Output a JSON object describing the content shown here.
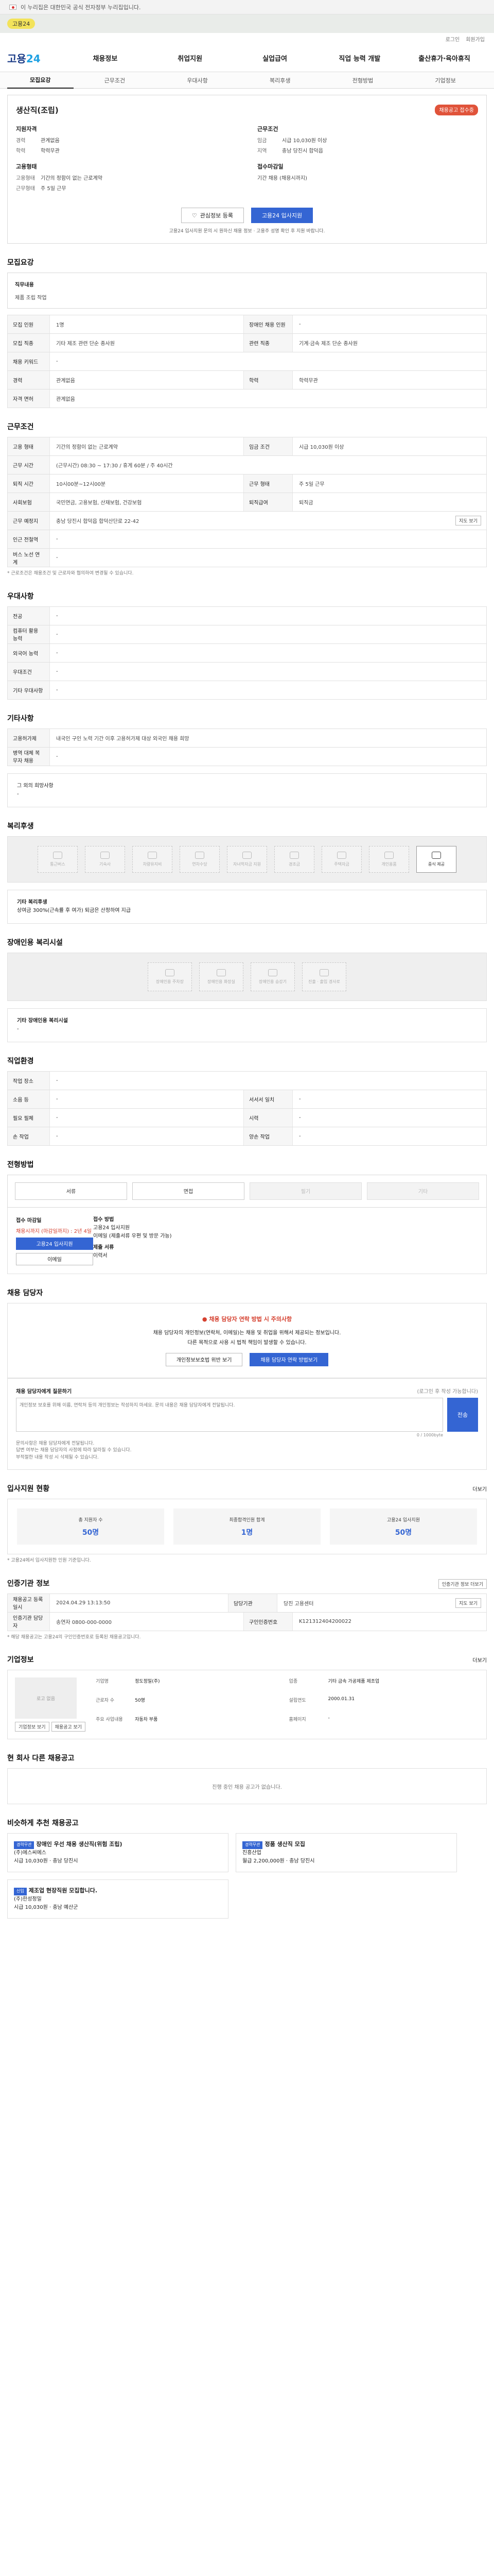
{
  "gov_banner": "이 누리집은 대한민국 공식 전자정부 누리집입니다.",
  "topbar": {
    "pill": "고용24",
    "util": [
      "로그인",
      "회원가입"
    ]
  },
  "logo": {
    "a": "고용",
    "b": "24"
  },
  "gnb": [
    "채용정보",
    "취업지원",
    "실업급여",
    "직업 능력 개발",
    "출산휴가·육아휴직"
  ],
  "subtabs": [
    "모집요강",
    "근무조건",
    "우대사항",
    "복리후생",
    "전형방법",
    "기업정보"
  ],
  "job": {
    "title": "생산직(조립)",
    "badge": "채용공고 접수중",
    "qualify_title": "지원자격",
    "qualify": [
      {
        "k": "경력",
        "v": "관계없음"
      },
      {
        "k": "학력",
        "v": "학력무관"
      }
    ],
    "form_title": "고용형태",
    "form": [
      {
        "k": "고용형태",
        "v": "기간의 정함이 없는 근로계약"
      },
      {
        "k": "근무형태",
        "v": "주 5일 근무"
      }
    ],
    "cond_title": "근무조건",
    "cond": [
      {
        "k": "임금",
        "v": "시급 10,030원 이상"
      },
      {
        "k": "지역",
        "v": "충남 당진시 합덕읍"
      }
    ],
    "period_title": "접수마감일",
    "period": "기간 채용 (채용시까지)",
    "btn_bookmark": "관심정보 등록",
    "btn_apply": "고용24 입사지원",
    "note": "고용24 입사지원 문의 시 원하신 채용 정보 · 고용주 성명 확인 후 지원 바랍니다."
  },
  "recruit": {
    "title": "모집요강",
    "job_name_label": "직무내용",
    "job_name": "제품 조립 작업",
    "rows": [
      {
        "th": "모집 인원",
        "td": "1명",
        "th2": "장애인 채용 인원",
        "td2": "-"
      },
      {
        "th": "모집 직종",
        "td": "기타 제조 관련 단순 종사원",
        "th2": "관련 직종",
        "td2": "기계·금속 제조 단순 종사원"
      },
      {
        "th": "채용 키워드",
        "td": "-",
        "th2": "",
        "td2": ""
      },
      {
        "th": "경력",
        "td": "관계없음",
        "th2": "학력",
        "td2": "학력무관"
      },
      {
        "th": "자격 면허",
        "td": "관계없음",
        "th2": "",
        "td2": ""
      }
    ]
  },
  "work": {
    "title": "근무조건",
    "rows": [
      {
        "th": "고용 형태",
        "td": "기간의 정함이 없는 근로계약",
        "th2": "임금 조건",
        "td2": "시급 10,030원 이상"
      },
      {
        "th": "근무 시간",
        "td": "(근무시간) 08:30 ~ 17:30 / 휴게 60분 / 주 40시간",
        "th2": "",
        "td2": ""
      },
      {
        "th": "퇴직 시간",
        "td": "10시00분~12시00분",
        "th2": "근무 형태",
        "td2": "주 5일 근무"
      },
      {
        "th": "사회보험",
        "td": "국민연금, 고용보험, 산재보험, 건강보험",
        "th2": "퇴직급여",
        "td2": "퇴직금"
      },
      {
        "th": "근무 예정지",
        "td": "충남 당진시 합덕읍 합덕산단로 22-42",
        "th2": "",
        "td2": "",
        "btn": "지도 보기"
      },
      {
        "th": "인근 전철역",
        "td": "-",
        "th2": "",
        "td2": ""
      },
      {
        "th": "버스 노선 연계",
        "td": "-",
        "th2": "",
        "td2": ""
      }
    ],
    "foot": "* 근로조건은 채용조건 및 근로자와 협의하여 변경될 수 있습니다."
  },
  "prefer": {
    "title": "우대사항",
    "rows": [
      {
        "th": "전공",
        "td": "-"
      },
      {
        "th": "컴퓨터 활용 능력",
        "td": "-"
      },
      {
        "th": "외국어 능력",
        "td": "-"
      },
      {
        "th": "우대조건",
        "td": "-"
      },
      {
        "th": "기타 우대사항",
        "td": "-"
      }
    ]
  },
  "etc": {
    "title": "기타사항",
    "rows": [
      {
        "th": "고용허가제",
        "td": "내국인 구인 노력 기간 이후 고용허가제 대상 외국인 채용 희망"
      },
      {
        "th": "병역 대체 복무자 채용",
        "td": "-"
      }
    ],
    "hope_label": "그 외의 희망사항",
    "hope": "-"
  },
  "welfare": {
    "title": "복리후생",
    "items": [
      {
        "label": "통근버스",
        "on": false
      },
      {
        "label": "기숙사",
        "on": false
      },
      {
        "label": "차량유지비",
        "on": false
      },
      {
        "label": "연차수당",
        "on": false
      },
      {
        "label": "자녀학자금 지원",
        "on": false
      },
      {
        "label": "경조금",
        "on": false
      },
      {
        "label": "주택자금",
        "on": false
      },
      {
        "label": "개인용품",
        "on": false
      },
      {
        "label": "중식 제공",
        "on": true
      }
    ],
    "detail_label": "기타 복리후생",
    "detail": "상여금 300%(근속률 후 여가) 퇴금은 산정하여 지급"
  },
  "disability": {
    "title": "장애인용 복리시설",
    "items": [
      {
        "label": "장애인용 주차장",
        "on": false
      },
      {
        "label": "장애인용 화장실",
        "on": false
      },
      {
        "label": "장애인용 승강기",
        "on": false
      },
      {
        "label": "진출 · 출입 경사로",
        "on": false
      }
    ],
    "detail_label": "기타 장애인용 복리시설",
    "detail": "-"
  },
  "process": {
    "title": "직업환경",
    "rows": [
      {
        "th": "작업 장소",
        "td": "-",
        "th2": "",
        "td2": ""
      },
      {
        "th": "소음 등",
        "td": "-",
        "th2": "서서서 일치",
        "td2": "-"
      },
      {
        "th": "필요 필체",
        "td": "-",
        "th2": "시력",
        "td2": "-"
      },
      {
        "th": "손 작업",
        "td": "-",
        "th2": "양손 작업",
        "td2": "-"
      }
    ]
  },
  "selection": {
    "title": "전형방법",
    "methods": [
      {
        "label": "서류",
        "on": true
      },
      {
        "label": "면접",
        "on": true
      },
      {
        "label": "필기",
        "on": false
      },
      {
        "label": "기타",
        "on": false
      }
    ],
    "apply_label": "접수 마감일",
    "apply_deadline": "채용시까지 (마감일까지) : 2년 4일",
    "btn_apply": "고용24 입사지원",
    "btn_email": "이메일",
    "r_label": "접수 방법",
    "r_lines": [
      "고용24 입사지원",
      "이메일 (제출서류 우편 및 방문 가능)",
      "제출 서류",
      "이력서"
    ]
  },
  "manager": {
    "title": "채용 담당자",
    "warn": "채용 담당자 연락 방법 시 주의사항",
    "text": "채용 담당자의 개인정보(연락처, 이메일)는 채용 및 취업을 위해서 제공되는 정보입니다.",
    "text2": "다른 목적으로 사용 시 법적 책임이 발생할 수 있습니다.",
    "btn_a": "개인정보보호법 위반 보기",
    "btn_b": "채용 담당자 연락 방법보기"
  },
  "qa": {
    "title": "채용 담당자에게 질문하기",
    "hint": "(로그인 후 작성 가능합니다)",
    "placeholder": "개인정보 보호를 위해 이름, 연락처 등의 개인정보는 작성하지 마세요. 문의 내용은 채용 담당자에게 전달됩니다.",
    "count": "0 / 1000byte",
    "send": "전송",
    "notes": [
      "문의사항은 채용 담당자에게 전달됩니다.",
      "답변 여부는 채용 담당자의 사정에 따라 달라질 수 있습니다.",
      "부적절한 내용 작성 시 삭제될 수 있습니다."
    ]
  },
  "status": {
    "title": "입사지원 현황",
    "more": "더보기",
    "items": [
      {
        "l": "총 지원자 수",
        "n": "50명"
      },
      {
        "l": "최종합격인원 합계",
        "n": "1명"
      },
      {
        "l": "고용24 입사지원",
        "n": "50명"
      }
    ],
    "foot": "* 고용24에서 입사지원한 인원 기준입니다."
  },
  "org": {
    "title": "인증기관 정보",
    "btn": "인증기관 정보 더보기",
    "rows": [
      {
        "th": "채용공고 등록일시",
        "td": "2024.04.29 13:13:50",
        "th2": "담당기관",
        "td2": "당진 고용센터",
        "btn": "지도 보기"
      },
      {
        "th": "인증기관 담당자",
        "td": "송연자 0800-000-0000",
        "th2": "구인인증번호",
        "td2": "K121312404200022"
      }
    ],
    "foot": "* 해당 채용공고는 고용24의 구인인증번호로 등록된 채용공고입니다."
  },
  "company": {
    "title": "기업정보",
    "more": "더보기",
    "logo": "로고 없음",
    "btn_a": "기업정보 보기",
    "btn_b": "채용공고 보기",
    "fields": [
      {
        "k": "기업명",
        "v": "정도정밀(주)"
      },
      {
        "k": "업종",
        "v": "기타 금속 가공제품 제조업"
      },
      {
        "k": "근로자 수",
        "v": "50명"
      },
      {
        "k": "설립연도",
        "v": "2000.01.31"
      },
      {
        "k": "주요 사업내용",
        "v": "자동차 부품"
      },
      {
        "k": "홈페이지",
        "v": "-"
      }
    ]
  },
  "same": {
    "title": "현 회사 다른 채용공고",
    "empty": "진행 중인 채용 공고가 없습니다."
  },
  "recos": {
    "title": "비슷하게 추천 채용공고",
    "items": [
      {
        "tag": "경력무관",
        "title": "장애인 우선 채용 생산직(위험 조립)",
        "co": "(주)에스씨에스",
        "wage": "시급 10,030원",
        "loc": "충남 당진시"
      },
      {
        "tag": "경력무관",
        "title": "정품 생산직 모집",
        "co": "진흥산업",
        "wage": "월급 2,200,000원",
        "loc": "충남 당진시"
      },
      {
        "tag": "신입",
        "title": "제조업 현장직원 모집합니다.",
        "co": "(주)한성정밀",
        "wage": "시급 10,030원",
        "loc": "충남 예산군"
      }
    ]
  }
}
